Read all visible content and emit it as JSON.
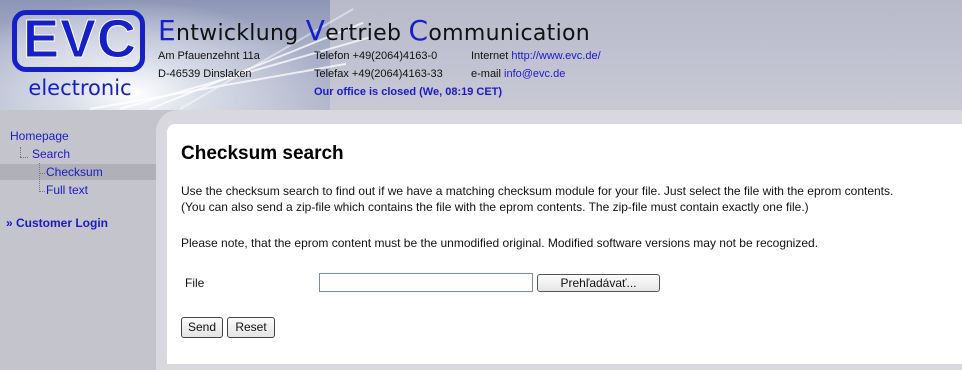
{
  "header": {
    "logo_text": "EVC",
    "logo_subtitle": "electronic",
    "company_words": [
      {
        "cap": "E",
        "rest": "ntwicklung "
      },
      {
        "cap": "V",
        "rest": "ertrieb "
      },
      {
        "cap": "C",
        "rest": "ommunication"
      }
    ],
    "address_line1": "Am Pfauenzehnt 11a",
    "address_line2": "D-46539 Dinslaken",
    "phone": "Telefon +49(2064)4163-0",
    "fax": "Telefax +49(2064)4163-33",
    "internet_label": "Internet",
    "internet_url": "http://www.evc.de/",
    "email_label": "e-mail",
    "email": "info@evc.de",
    "office_status": "Our office is closed (We, 08:19 CET)"
  },
  "sidebar": {
    "items": [
      {
        "label": "Homepage"
      },
      {
        "label": "Search"
      },
      {
        "label": "Checksum"
      },
      {
        "label": "Full text"
      }
    ],
    "login_label": "» Customer Login"
  },
  "main": {
    "title": "Checksum search",
    "intro_line1": "Use the checksum search to find out if we have a matching checksum module for your file. Just select the file with the eprom contents.",
    "intro_line2": "(You can also send a zip-file which contains the file with the eprom contents. The zip-file must contain exactly one file.)",
    "note": "Please note, that the eprom content must be the unmodified original. Modified software versions may not be recognized.",
    "form": {
      "file_label": "File",
      "file_value": "",
      "browse_label": "Prehľadávať...",
      "send_label": "Send",
      "reset_label": "Reset"
    }
  },
  "colors": {
    "brand_blue": "#1520c8",
    "link_blue": "#1a1ac8",
    "sidebar_bg": "#c4c4cc",
    "active_item_bg": "#b0b0b8"
  }
}
